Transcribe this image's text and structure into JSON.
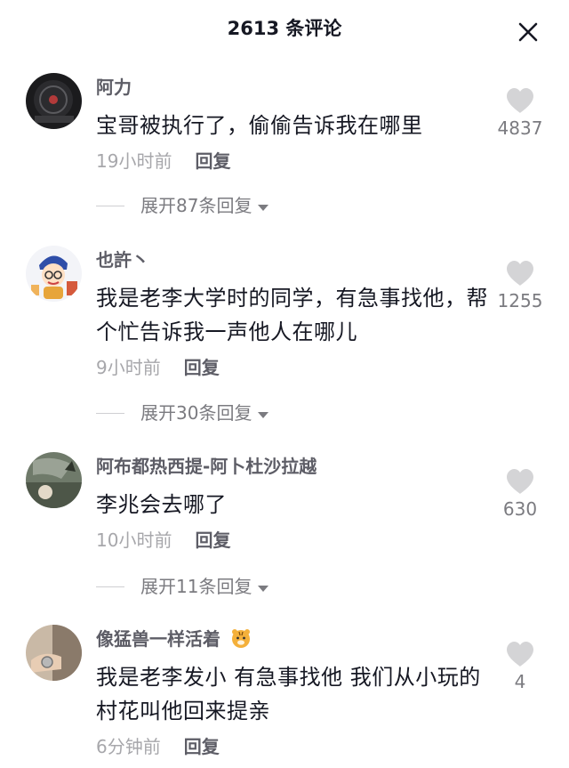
{
  "header": {
    "title": "2613 条评论"
  },
  "comments": [
    {
      "username": "阿力",
      "text": "宝哥被执行了，偷偷告诉我在哪里",
      "time": "19小时前",
      "reply": "回复",
      "likes": "4837",
      "expand": "展开87条回复"
    },
    {
      "username": "也許丶",
      "text": "我是老李大学时的同学，有急事找他，帮个忙告诉我一声他人在哪儿",
      "time": "9小时前",
      "reply": "回复",
      "likes": "1255",
      "expand": "展开30条回复"
    },
    {
      "username": "阿布都热西提-阿卜杜沙拉越",
      "text": "李兆会去哪了",
      "time": "10小时前",
      "reply": "回复",
      "likes": "630",
      "expand": "展开11条回复"
    },
    {
      "username": "像猛兽一样活着",
      "text": "我是老李发小 有急事找他 我们从小玩的村花叫他回来提亲",
      "time": "6分钟前",
      "reply": "回复",
      "likes": "4"
    }
  ],
  "icons": {
    "close": "close-icon",
    "like": "heart-icon",
    "expand": "chevron-down-icon",
    "username_emoji": "tiger-emoji-icon"
  },
  "colors": {
    "text_primary": "#161823",
    "text_secondary": "#7b7b80",
    "heart": "#d4d4d6"
  }
}
